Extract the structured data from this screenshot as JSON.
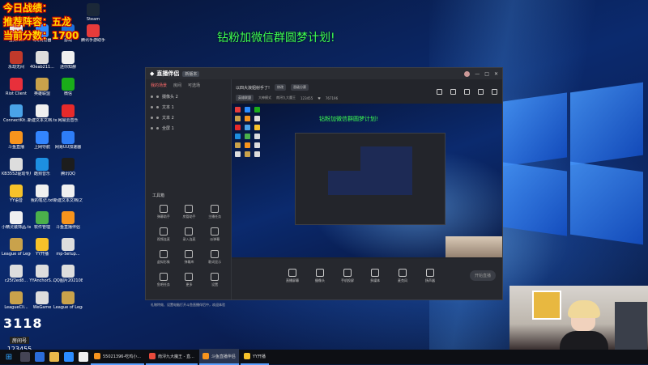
{
  "overlay": {
    "line1": "今日战绩：",
    "line2": "推荐阵容：五龙",
    "line3": "当前分数：1700"
  },
  "banner": "钻粉加微信群圆梦计划!",
  "desktop_icons": [
    {
      "label": "宝贝.txt",
      "color": "#e8e8e8"
    },
    {
      "label": "QQ浏览器",
      "color": "#2b8cff"
    },
    {
      "label": "游戏",
      "color": "#1d6fd8"
    },
    {
      "label": "腾讯手游助手",
      "color": "#e63b3b"
    },
    {
      "label": "Steam",
      "color": "#1b2838"
    },
    {
      "label": "永劫无间",
      "color": "#c0392b"
    },
    {
      "label": "40eab211...",
      "color": "#dddddd"
    },
    {
      "label": "迷你知赫",
      "color": "#f0f0f0"
    },
    {
      "label": "Riot Client",
      "color": "#e8303b"
    },
    {
      "label": "英雄联盟",
      "color": "#c9a24b"
    },
    {
      "label": "微信",
      "color": "#1aad19"
    },
    {
      "label": "ConnectKit...",
      "color": "#4aa3e8"
    },
    {
      "label": "新建文本文档.txt",
      "color": "#f0f0f0"
    },
    {
      "label": "网易云音乐",
      "color": "#e62a2a"
    },
    {
      "label": "斗鱼直播",
      "color": "#f7941d"
    },
    {
      "label": "上网导航",
      "color": "#3385ff"
    },
    {
      "label": "网易UU加速器",
      "color": "#2e7df6"
    },
    {
      "label": "KB3552驱动专用驱动.exe",
      "color": "#dddddd"
    },
    {
      "label": "酷狗音乐",
      "color": "#1d8fe1"
    },
    {
      "label": "腾讯QQ",
      "color": "#1d1d1d"
    },
    {
      "label": "YY语音",
      "color": "#f6c22a"
    },
    {
      "label": "我的笔记.txt",
      "color": "#f0f0f0"
    },
    {
      "label": "新建文本文档(2).txt",
      "color": "#f0f0f0"
    },
    {
      "label": "小精灵装饰品.txt",
      "color": "#f0f0f0"
    },
    {
      "label": "软件管理",
      "color": "#4bb04b"
    },
    {
      "label": "斗鱼直播伴侣",
      "color": "#f7941d"
    },
    {
      "label": "League of Legends",
      "color": "#c9a24b"
    },
    {
      "label": "YY开播",
      "color": "#f6c22a"
    },
    {
      "label": "mp-Setup...",
      "color": "#dddddd"
    },
    {
      "label": "c25f2ed8...",
      "color": "#dddddd"
    },
    {
      "label": "YYAnchorS...",
      "color": "#dddddd"
    },
    {
      "label": "QQ图片20210824...",
      "color": "#dddddd"
    },
    {
      "label": "LeagueCli...",
      "color": "#c9a24b"
    },
    {
      "label": "WeGame",
      "color": "#dddddd"
    },
    {
      "label": "League of Legends...",
      "color": "#c9a24b"
    }
  ],
  "app": {
    "title": "直播伴侣",
    "badge": "新版本",
    "left_tabs": [
      "我的场景",
      "房间",
      "可选场"
    ],
    "scenes": [
      "摄像头 2",
      "文本 1",
      "文本 2",
      "全屏 1"
    ],
    "tools_title": "工具箱",
    "tools": [
      "弹幕助手",
      "房管助手",
      "主播任务",
      "视频连麦",
      "录入连麦",
      "派弹幕",
      "虚拟形象",
      "弹幕库",
      "歌词显示",
      "鱼吧任务",
      "更多",
      "设置"
    ],
    "notice": "礼物特效、设置电脑打开斗鱼直播伴侣中，欢迎体验",
    "room_title": "以四大浪姐射手了!",
    "room_edit": "修改",
    "category": "晋级分赛",
    "meta_tag": "英雄联盟",
    "meta_sub": "大神模式",
    "meta_game": "南浔九大魔王",
    "meta_id": "123455",
    "meta_fans": "767196",
    "preview_banner": "钻粉加微信群圆梦计划!",
    "bottom_buttons": [
      "直播屏幕",
      "摄像头",
      "手机投屏",
      "多媒体",
      "麦克风",
      "扬声器"
    ],
    "start_button": "开始直播"
  },
  "room_number": {
    "big": "3118",
    "label": "房间号",
    "id": "123455"
  },
  "taskbar": {
    "items": [
      {
        "label": "55021396-吃鸡小...",
        "color": "#f7941d"
      },
      {
        "label": "南浔九大魔王 - 直...",
        "color": "#e94b3c"
      },
      {
        "label": "斗鱼直播伴侣",
        "color": "#f7941d"
      },
      {
        "label": "YY开播",
        "color": "#f6c22a"
      }
    ]
  }
}
